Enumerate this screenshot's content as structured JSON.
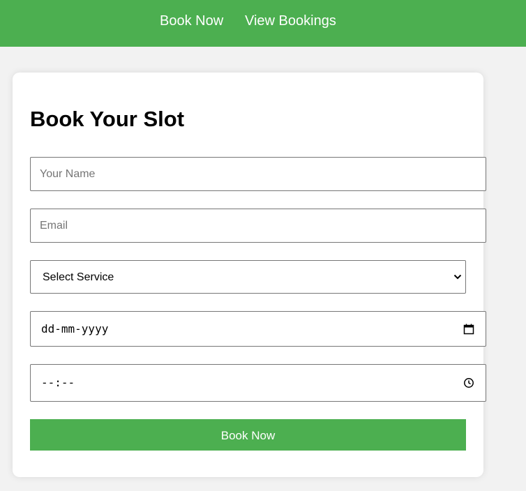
{
  "nav": {
    "links": [
      {
        "label": "Book Now"
      },
      {
        "label": "View Bookings"
      }
    ]
  },
  "form": {
    "title": "Book Your Slot",
    "name": {
      "placeholder": "Your Name",
      "value": ""
    },
    "email": {
      "placeholder": "Email",
      "value": ""
    },
    "service": {
      "selected": "Select Service"
    },
    "date": {
      "display": "dd-mm-yyyy"
    },
    "time": {
      "display": "--:--"
    },
    "submit_label": "Book Now"
  },
  "colors": {
    "accent": "#4caf50",
    "background": "#f2f2f2",
    "card": "#ffffff"
  },
  "icons": {
    "date_picker": "calendar-icon",
    "time_picker": "clock-icon",
    "select": "chevron-down-icon"
  }
}
